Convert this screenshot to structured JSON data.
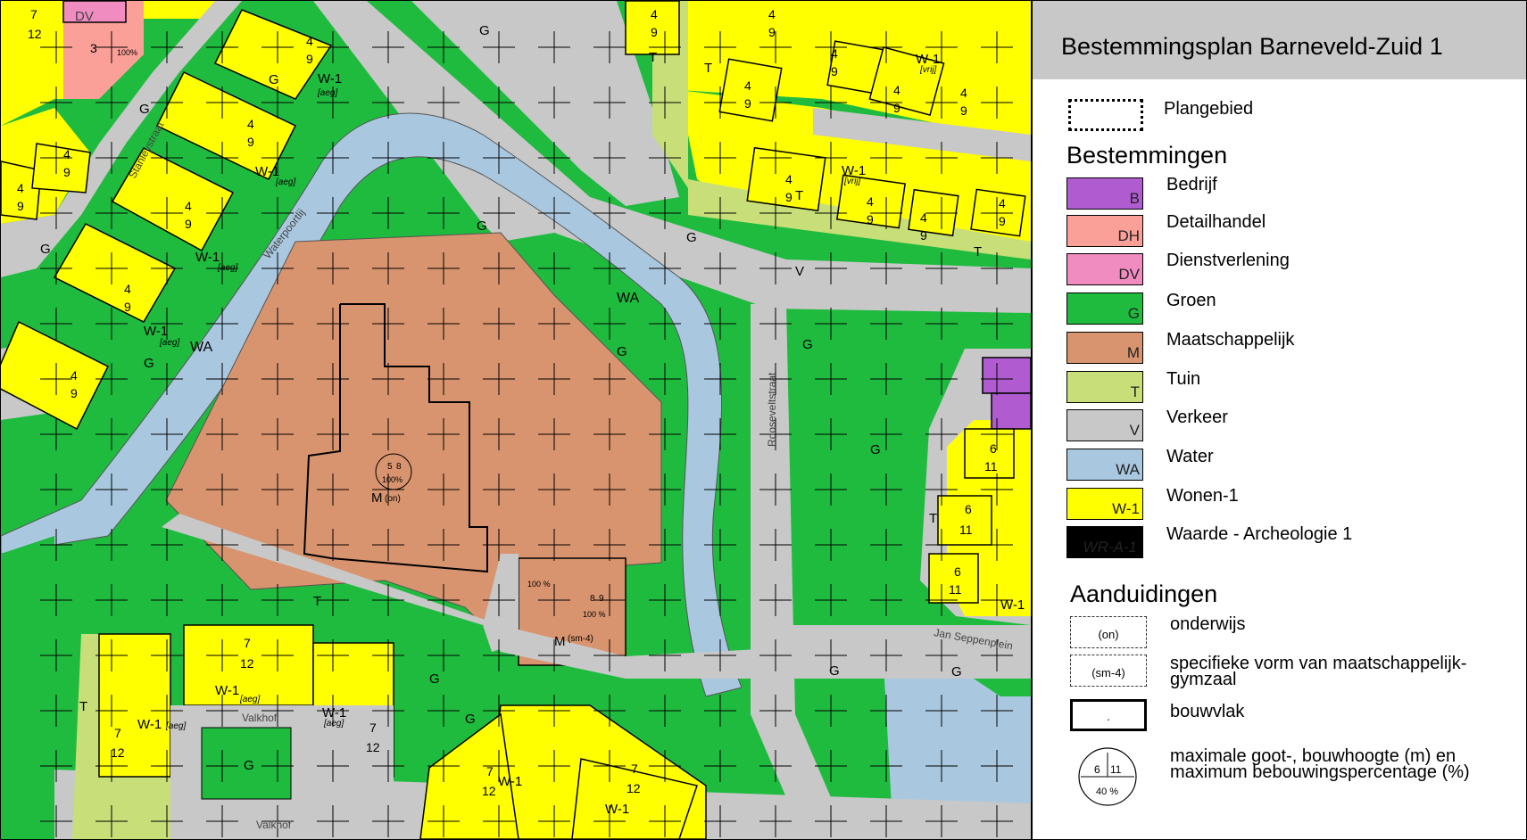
{
  "title": "Bestemmingsplan  Barneveld-Zuid 1",
  "colors": {
    "bedrijf": "#b05cd0",
    "detailhandel": "#fba098",
    "dienstverlening": "#f08cc0",
    "groen": "#1fbb3f",
    "maatschappelijk": "#d8946e",
    "tuin": "#c8de78",
    "verkeer": "#c8c8c8",
    "water": "#a9c8e0",
    "wonen": "#ffff00"
  },
  "legend": {
    "plangebied_label": "Plangebied",
    "bestemmingen_heading": "Bestemmingen",
    "bestemmingen": [
      {
        "code": "B",
        "label": "Bedrijf",
        "color": "#b05cd0"
      },
      {
        "code": "DH",
        "label": "Detailhandel",
        "color": "#fba098"
      },
      {
        "code": "DV",
        "label": "Dienstverlening",
        "color": "#f08cc0"
      },
      {
        "code": "G",
        "label": "Groen",
        "color": "#1fbb3f"
      },
      {
        "code": "M",
        "label": "Maatschappelijk",
        "color": "#d8946e"
      },
      {
        "code": "T",
        "label": "Tuin",
        "color": "#c8de78"
      },
      {
        "code": "V",
        "label": "Verkeer",
        "color": "#c8c8c8"
      },
      {
        "code": "WA",
        "label": "Water",
        "color": "#a9c8e0"
      },
      {
        "code": "W-1",
        "label": "Wonen-1",
        "color": "#ffff00"
      },
      {
        "code": "WR-A-1",
        "label": "Waarde - Archeologie 1",
        "color": "#ffffff"
      }
    ],
    "aanduidingen_heading": "Aanduidingen",
    "aanduidingen": [
      {
        "code": "(on)",
        "label_lines": [
          "onderwijs"
        ]
      },
      {
        "code": "(sm-4)",
        "label_lines": [
          "specifieke vorm van maatschappelijk-",
          "gymzaal"
        ]
      },
      {
        "code": "·",
        "label_lines": [
          "bouwvlak"
        ]
      }
    ],
    "maxhoogte": {
      "goot": "6",
      "bouw": "11",
      "percentage": "40 %",
      "label_lines": [
        "maximale goot-, bouwhoogte (m) en",
        "maximum bebouwingspercentage (%)"
      ]
    }
  },
  "map": {
    "zone_labels": {
      "g": "G",
      "t": "T",
      "v": "V",
      "wa": "WA",
      "w1": "W-1",
      "dv": "DV"
    },
    "school_code": "M",
    "school_sub": "(on)",
    "gym_code": "M",
    "gym_sub": "(sm-4)",
    "aeg": "[aeg]",
    "vrij": "[vrij]",
    "pct100": "100%",
    "pct100b": "100 %",
    "streets": {
      "stanleystraat": "Stanleystraat",
      "waterpoortlij": "Waterpoortlij",
      "rooseveltstraat": "Rooseveltstraat",
      "jan_seppenplein": "Jan Seppenplein",
      "valkhof": "Valkhof"
    },
    "heights": {
      "h4": "4",
      "h9": "9",
      "h7": "7",
      "h12": "12",
      "h6": "6",
      "h11": "11",
      "h5": "5",
      "h8": "8",
      "h3": "3"
    }
  }
}
